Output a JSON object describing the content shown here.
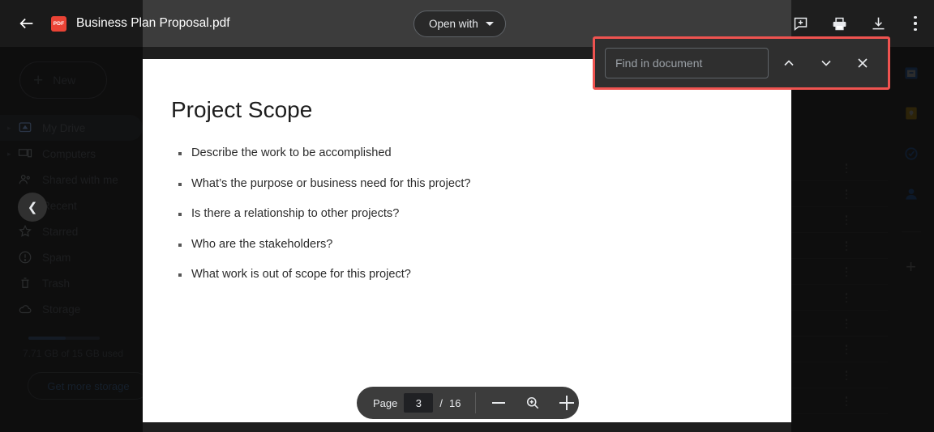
{
  "header": {
    "back_label": "Back",
    "file_type_badge": "PDF",
    "title": "Business Plan Proposal.pdf",
    "open_with_label": "Open with",
    "actions": [
      {
        "name": "add-comment-icon",
        "label": "Add a comment"
      },
      {
        "name": "print-icon",
        "label": "Print"
      },
      {
        "name": "download-icon",
        "label": "Download"
      },
      {
        "name": "more-actions-icon",
        "label": "More actions"
      }
    ]
  },
  "find_bar": {
    "placeholder": "Find in document",
    "value": "",
    "previous_label": "Previous",
    "next_label": "Next",
    "close_label": "Close",
    "highlight_color": "#ef5350"
  },
  "document": {
    "title": "Project Scope",
    "bullets": [
      "Describe the work to be accomplished",
      "What’s the purpose or business need for this project?",
      "Is there a relationship to other projects?",
      "Who are the stakeholders?",
      "What work is out of scope for this project?"
    ]
  },
  "page_toolbar": {
    "page_label": "Page",
    "current_page": "3",
    "separator": "/",
    "total_pages": "16",
    "zoom_out_label": "Zoom out",
    "zoom_label": "Zoom",
    "zoom_in_label": "Zoom in"
  },
  "sidebar": {
    "new_button": "New",
    "items": [
      {
        "label": "My Drive",
        "icon": "drive-icon",
        "expandable": true,
        "active": true
      },
      {
        "label": "Computers",
        "icon": "computer-icon",
        "expandable": true,
        "active": false
      },
      {
        "label": "Shared with me",
        "icon": "people-icon",
        "expandable": false,
        "active": false
      },
      {
        "label": "Recent",
        "icon": "clock-icon",
        "expandable": false,
        "active": false
      },
      {
        "label": "Starred",
        "icon": "star-icon",
        "expandable": false,
        "active": false
      },
      {
        "label": "Spam",
        "icon": "spam-icon",
        "expandable": false,
        "active": false
      },
      {
        "label": "Trash",
        "icon": "trash-icon",
        "expandable": false,
        "active": false
      },
      {
        "label": "Storage",
        "icon": "cloud-icon",
        "expandable": false,
        "active": false
      }
    ],
    "storage_text": "7.71 GB of 15 GB used",
    "get_more_storage": "Get more storage",
    "collapse_label": "Collapse sidebar"
  },
  "side_rail": {
    "items": [
      {
        "name": "calendar-icon",
        "label": "Calendar"
      },
      {
        "name": "keep-icon",
        "label": "Keep"
      },
      {
        "name": "tasks-icon",
        "label": "Tasks"
      },
      {
        "name": "contacts-icon",
        "label": "Contacts"
      }
    ],
    "add_label": "Get add-ons"
  },
  "colors": {
    "accent_red": "#ea4335",
    "header_bg": "#3c3c3c",
    "overlay_bg": "#1e1e1e",
    "page_bg": "#ffffff"
  }
}
